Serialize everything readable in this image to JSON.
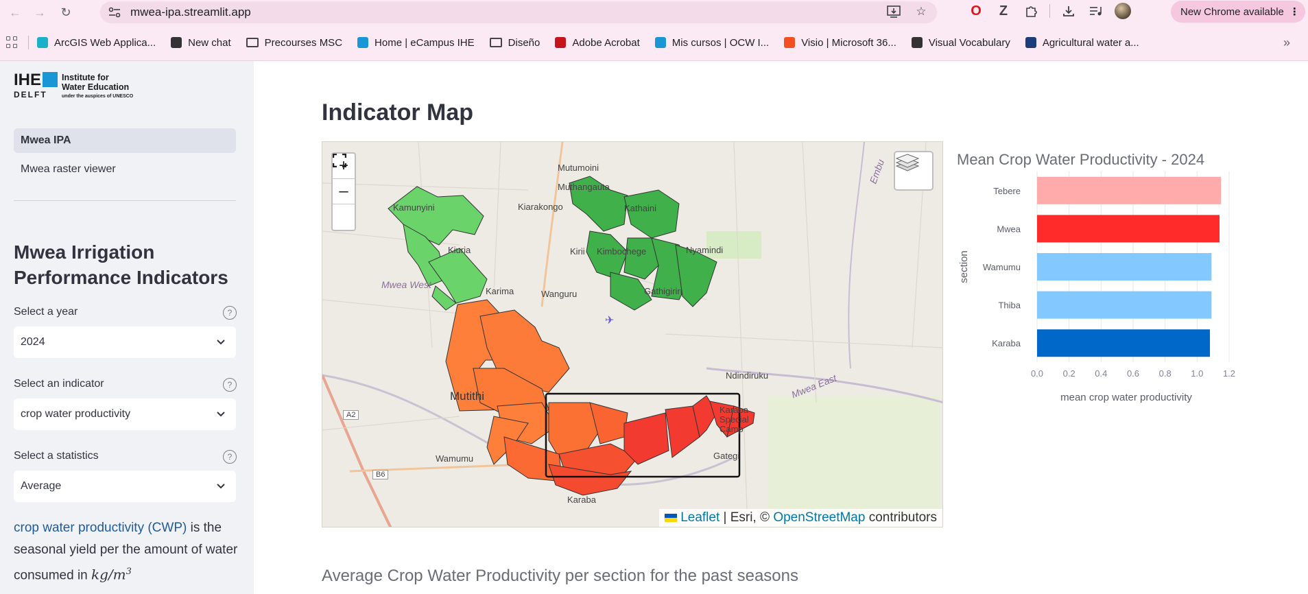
{
  "browser": {
    "url": "mwea-ipa.streamlit.app",
    "update_label": "New Chrome available",
    "bookmarks": [
      {
        "label": "ArcGIS Web Applica...",
        "icon": "arcgis-icon",
        "color": "#1ab0c9"
      },
      {
        "label": "New chat",
        "icon": "openai-icon",
        "color": "#333333"
      },
      {
        "label": "Precourses MSC",
        "icon": "folder-icon",
        "color": "#444444"
      },
      {
        "label": "Home | eCampus IHE",
        "icon": "ihe-icon",
        "color": "#1a96d4"
      },
      {
        "label": "Diseño",
        "icon": "folder-icon",
        "color": "#444444"
      },
      {
        "label": "Adobe Acrobat",
        "icon": "acrobat-icon",
        "color": "#c4151c"
      },
      {
        "label": "Mis cursos | OCW I...",
        "icon": "ihe-icon",
        "color": "#1a96d4"
      },
      {
        "label": "Visio | Microsoft 36...",
        "icon": "microsoft-icon",
        "color": "#f25022"
      },
      {
        "label": "Visual Vocabulary",
        "icon": "globe-icon",
        "color": "#333333"
      },
      {
        "label": "Agricultural water a...",
        "icon": "data-icon",
        "color": "#1d3c7a"
      }
    ]
  },
  "sidebar": {
    "logo": {
      "ihe": "IHE",
      "delft": "DELFT",
      "line1": "Institute for",
      "line2": "Water Education",
      "line3": "under the auspices of UNESCO"
    },
    "nav": [
      {
        "label": "Mwea IPA",
        "active": true
      },
      {
        "label": "Mwea raster viewer",
        "active": false
      }
    ],
    "title": "Mwea Irrigation Performance Indicators",
    "fields": [
      {
        "label": "Select a year",
        "value": "2024"
      },
      {
        "label": "Select an indicator",
        "value": "crop water productivity"
      },
      {
        "label": "Select a statistics",
        "value": "Average"
      }
    ],
    "description": {
      "link": "crop water productivity (CWP)",
      "text1": " is the seasonal yield per the amount of water consumed in ",
      "unit_base": "kg/m",
      "unit_exp": "3"
    }
  },
  "main": {
    "title": "Indicator Map",
    "map": {
      "labels": {
        "mutumoini": "Mutumoini",
        "muthangauta": "Muthangauta",
        "kiarakongo": "Kiarakongo",
        "kamunyini": "Kamunyini",
        "kiuria": "Kiuria",
        "kirii": "Kirii",
        "kimbochege": "Kimbochege",
        "nyamindi": "Nyamindi",
        "kathaini": "Kathaini",
        "mwea_west": "Mwea West",
        "karima": "Karima",
        "wanguru": "Wanguru",
        "gathigiriri": "Gathigiriri",
        "ndindiruku": "Ndindiruku",
        "mwea_east": "Mwea East",
        "embu": "Embu",
        "mutithi": "Mutithi",
        "a2": "A2",
        "b6": "B6",
        "karaba_special_camp": "Karaba Special Camp",
        "gategi": "Gategi",
        "wamumu": "Wamumu",
        "karaba": "Karaba"
      },
      "attribution": {
        "leaflet": "Leaflet",
        "esri": " | Esri, © ",
        "osm": "OpenStreetMap",
        "contributors": " contributors"
      }
    },
    "bottom_heading": "Average Crop Water Productivity per section for the past seasons"
  },
  "chart_data": {
    "type": "bar",
    "orientation": "horizontal",
    "title": "Mean Crop Water Productivity - 2024",
    "xlabel": "mean crop water productivity",
    "ylabel": "section",
    "categories": [
      "Tebere",
      "Mwea",
      "Wamumu",
      "Thiba",
      "Karaba"
    ],
    "values": [
      1.15,
      1.14,
      1.09,
      1.09,
      1.08
    ],
    "colors": [
      "#ffabab",
      "#ff2b2b",
      "#83c9ff",
      "#83c9ff",
      "#0068c9"
    ],
    "xlim": [
      0,
      1.2
    ],
    "xticks": [
      "0.0",
      "0.2",
      "0.4",
      "0.6",
      "0.8",
      "1.0",
      "1.2"
    ],
    "grid": true
  }
}
